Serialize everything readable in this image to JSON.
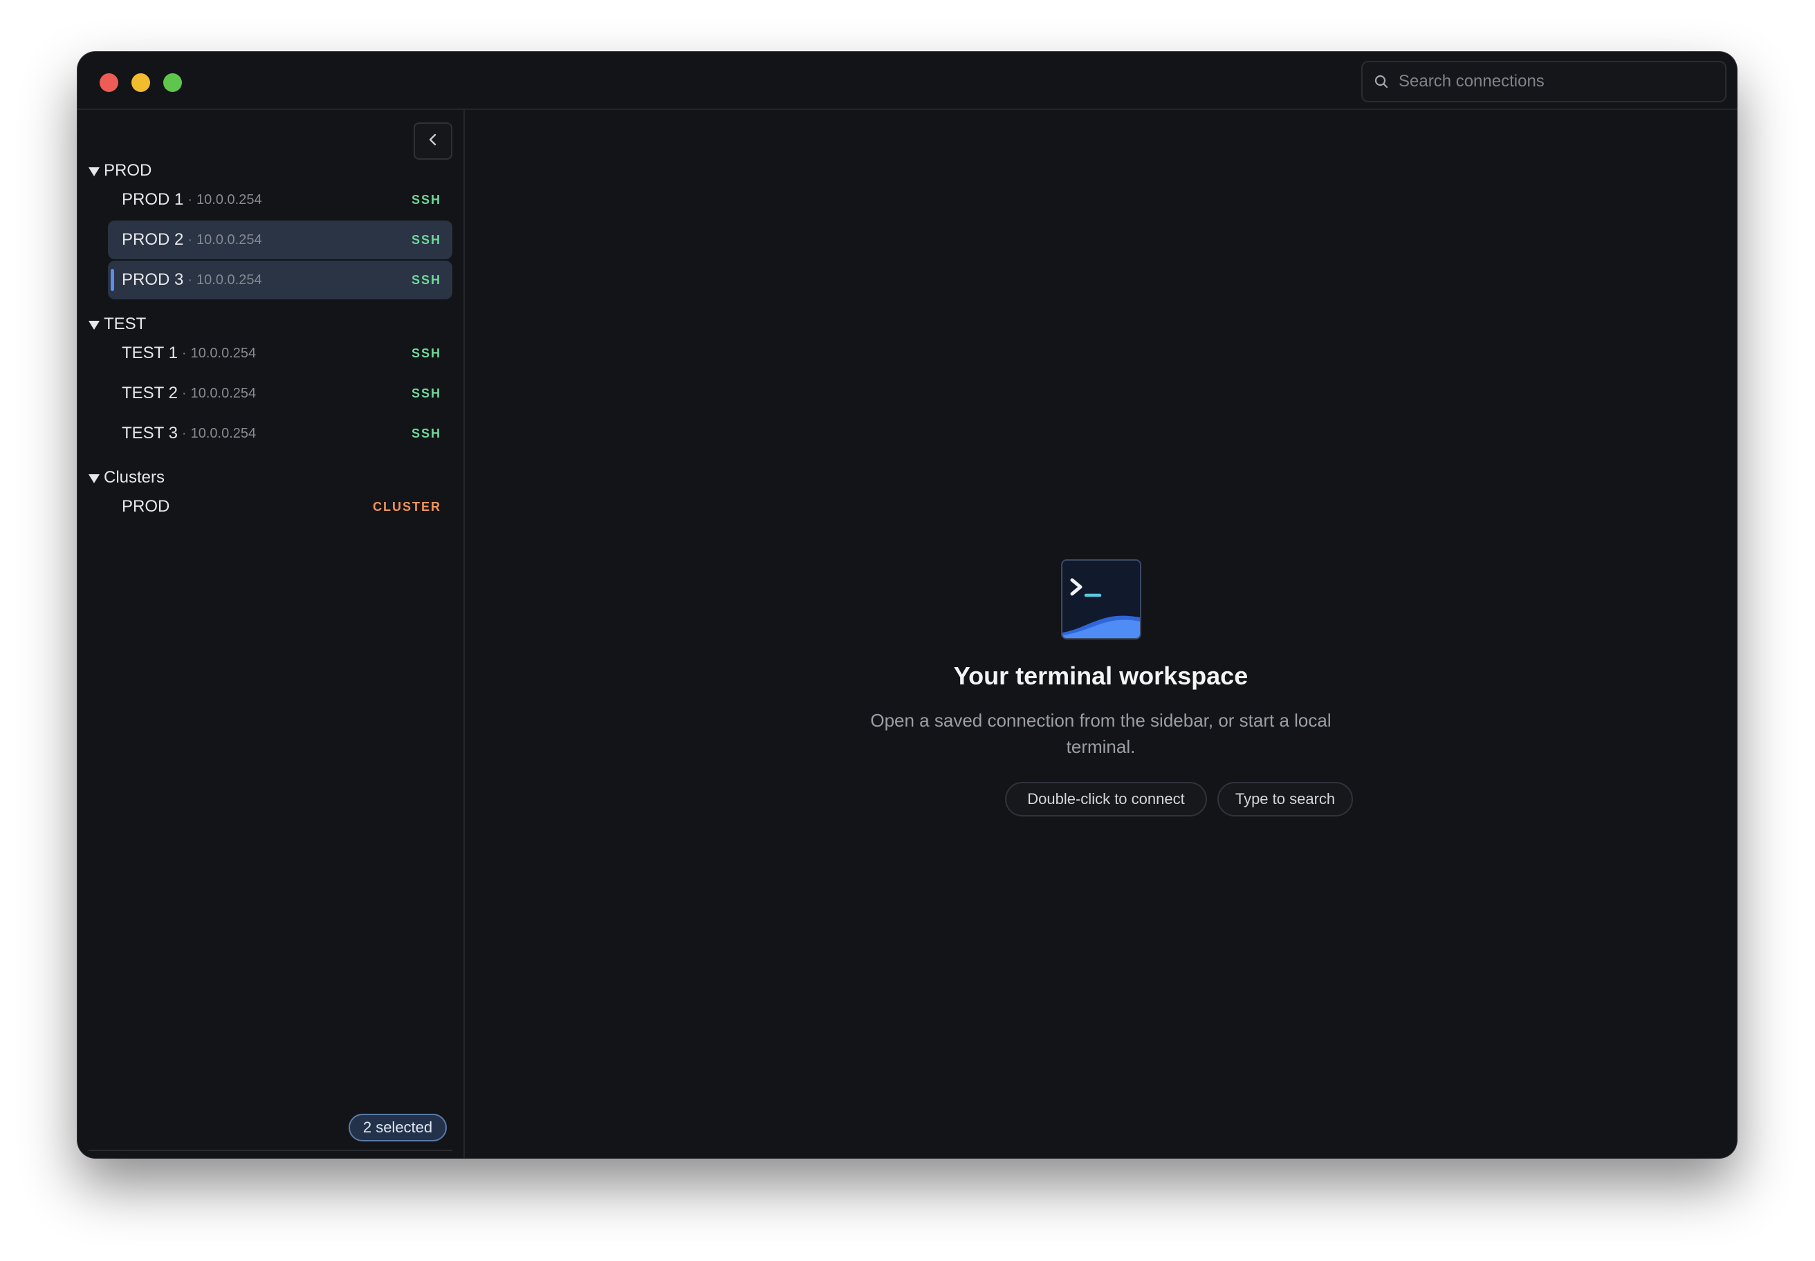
{
  "search": {
    "placeholder": "Search connections"
  },
  "groups": [
    {
      "label": "PROD",
      "items": [
        {
          "name": "PROD 1",
          "address": "10.0.0.254",
          "protocol": "SSH"
        },
        {
          "name": "PROD 2",
          "address": "10.0.0.254",
          "protocol": "SSH"
        },
        {
          "name": "PROD 3",
          "address": "10.0.0.254",
          "protocol": "SSH"
        }
      ]
    },
    {
      "label": "TEST",
      "items": [
        {
          "name": "TEST 1",
          "address": "10.0.0.254",
          "protocol": "SSH"
        },
        {
          "name": "TEST 2",
          "address": "10.0.0.254",
          "protocol": "SSH"
        },
        {
          "name": "TEST 3",
          "address": "10.0.0.254",
          "protocol": "SSH"
        }
      ]
    },
    {
      "label": "Clusters",
      "items": [
        {
          "name": "PROD",
          "protocol": "CLUSTER"
        }
      ]
    }
  ],
  "separator": "·",
  "selection": {
    "label": "2 selected"
  },
  "toolbar": {
    "buttons": [
      "sync-icon",
      "gear-icon",
      "plus-icon",
      "plus-sparkle-icon",
      "link-icon",
      "import-icon",
      "terminal-icon"
    ]
  },
  "empty_state": {
    "title": "Your terminal workspace",
    "subtitle": "Open a saved connection from the sidebar, or start a local terminal.",
    "hints": [
      "Double-click to connect",
      "Type to search"
    ]
  },
  "colors": {
    "ssh": "#6fd89a",
    "cluster": "#f0955c",
    "selection_accent": "#5b8def"
  }
}
